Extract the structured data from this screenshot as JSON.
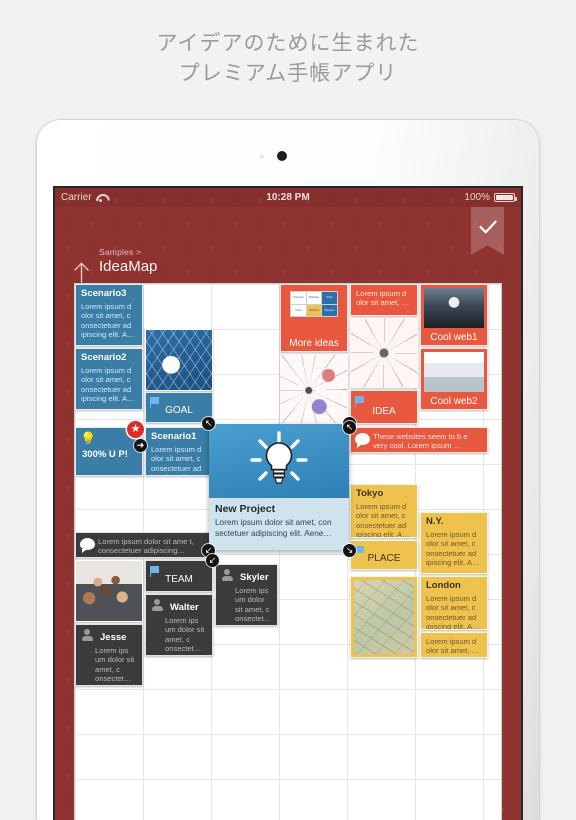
{
  "promo": {
    "line1": "アイデアのために生まれた",
    "line2": "プレミアム手帳アプリ"
  },
  "status_bar": {
    "carrier": "Carrier",
    "wifi_icon": "wifi-icon",
    "time": "10:28 PM",
    "battery_percent": "100%",
    "battery_icon": "battery-icon"
  },
  "toolbar": {
    "done_icon": "checkmark-icon",
    "back_icon": "up-arrow-icon"
  },
  "breadcrumb": {
    "parent": "Samples >",
    "title": "IdeaMap"
  },
  "colors": {
    "canvas_bg": "#8e3330",
    "blue_card": "#3a7da6",
    "red_card": "#e8583f",
    "yellow_card": "#eec24d",
    "dark_card": "#3b3b3d",
    "accent_star": "#e02b26"
  },
  "lorem": {
    "short": "Lorem ipsum d olor sit amet, c onsectetuer ad ipiscing elit. A…",
    "narrow": "Lorem ips um dolor sit amet, c onsectet…",
    "two_line": "Lorem ipsum d olor sit amet, …",
    "wide": "Lorem ipsum dolor sit amet, con sectetuer adipiscing elit. Aene…",
    "comment_dark": "Lorem ipsum dolor sit ame t, consectetuer adipiscing…",
    "comment_red": "These websites seem to b e very cool. Lorem ipsum …"
  },
  "cards": {
    "scenario3": {
      "title": "Scenario3",
      "body": "Lorem ipsum d olor sit amet, c onsectetuer ad ipiscing elit. A…"
    },
    "scenario2": {
      "title": "Scenario2",
      "body": "Lorem ipsum d olor sit amet, c onsectetuer ad ipiscing elit. A…"
    },
    "scenario1": {
      "title": "Scenario1",
      "body": "Lorem ipsum d olor sit amet, c onsectetuer ad ipiscing elit. A…"
    },
    "goal": {
      "label": "GOAL",
      "icon": "flag-icon",
      "image": "soccer-ball-image"
    },
    "growth": {
      "label": "300% U P!",
      "icon": "lightbulb-icon",
      "badge": "star-badge"
    },
    "new_project": {
      "title": "New Project",
      "body": "Lorem ipsum dolor sit amet, con sectetuer adipiscing elit. Aene…",
      "image": "lightbulb-image"
    },
    "more_ideas": {
      "label": "More ideas",
      "image": "matrix-diagram-image",
      "matrix_cells": [
        "Payment",
        "Matches",
        "Price",
        "Price",
        "Matches",
        "Payment"
      ]
    },
    "red_note": {
      "body": "Lorem ipsum d olor sit amet, …"
    },
    "idea": {
      "label": "IDEA",
      "icon": "flag-icon",
      "image": "mind-map-image"
    },
    "cool_web1": {
      "label": "Cool web1",
      "image": "mac-website-screenshot"
    },
    "cool_web2": {
      "label": "Cool web2",
      "image": "car-website-screenshot"
    },
    "mindmap_pink": {
      "image": "mind-map-image"
    },
    "comment_red": {
      "body": "These websites seem to b e very cool. Lorem ipsum …",
      "icon": "comment-bubble-icon"
    },
    "tokyo": {
      "title": "Tokyo",
      "body": "Lorem ipsum d olor sit amet, c onsectetuer ad ipiscing elit. A…"
    },
    "place": {
      "label": "PLACE",
      "icon": "flag-icon"
    },
    "ny": {
      "title": "N.Y.",
      "body": "Lorem ipsum d olor sit amet, c onsectetuer ad ipiscing elit. A…"
    },
    "london": {
      "title": "London",
      "body": "Lorem ipsum d olor sit amet, c onsectetuer ad ipiscing elit. A…"
    },
    "rome_map": {
      "image": "rome-map-image"
    },
    "yellow_note": {
      "body": "Lorem ipsum d olor sit amet, …"
    },
    "comment_dark": {
      "body": "Lorem ipsum dolor sit ame t, consectetuer adipiscing…",
      "icon": "comment-bubble-icon"
    },
    "team_photo": {
      "image": "team-photo-image"
    },
    "team": {
      "label": "TEAM",
      "icon": "flag-icon"
    },
    "walter": {
      "title": "Walter",
      "body": "Lorem ips um dolor sit amet, c onsectet…",
      "icon": "person-icon"
    },
    "skyler": {
      "title": "Skyler",
      "body": "Lorem ips um dolor sit amet, c onsectet…",
      "icon": "person-icon"
    },
    "jesse": {
      "title": "Jesse",
      "body": "Lorem ips um dolor sit amet, c onsectet…",
      "icon": "person-icon"
    }
  },
  "handles": {
    "tl": "↖",
    "tr": "↗",
    "bl": "↙",
    "br": "↘",
    "right": "➜"
  }
}
